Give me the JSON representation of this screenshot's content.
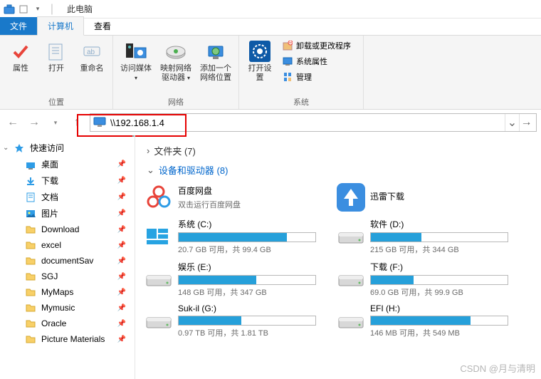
{
  "title": "此电脑",
  "tabs": {
    "file": "文件",
    "computer": "计算机",
    "view": "查看"
  },
  "ribbon": {
    "location": {
      "label": "位置",
      "props": "属性",
      "open": "打开",
      "rename": "重命名"
    },
    "network": {
      "label": "网络",
      "media": "访问媒体",
      "mapdrive": "映射网络驱动器",
      "addloc": "添加一个网络位置"
    },
    "system": {
      "label": "系统",
      "opensettings": "打开设置",
      "uninstall": "卸载或更改程序",
      "sysprops": "系统属性",
      "manage": "管理"
    }
  },
  "address": "\\\\192.168.1.4",
  "sidebar": {
    "quickaccess": "快速访问",
    "items": [
      {
        "label": "桌面"
      },
      {
        "label": "下载"
      },
      {
        "label": "文档"
      },
      {
        "label": "图片"
      },
      {
        "label": "Download"
      },
      {
        "label": "excel"
      },
      {
        "label": "documentSav"
      },
      {
        "label": "SGJ"
      },
      {
        "label": "MyMaps"
      },
      {
        "label": "Mymusic"
      },
      {
        "label": "Oracle"
      },
      {
        "label": "Picture Materials"
      }
    ]
  },
  "sections": {
    "folders": "文件夹 (7)",
    "devices": "设备和驱动器 (8)"
  },
  "apps": [
    {
      "name": "百度网盘",
      "sub": "双击运行百度网盘"
    },
    {
      "name": "迅雷下载",
      "sub": ""
    }
  ],
  "drives": [
    {
      "name": "系统 (C:)",
      "free": "20.7 GB 可用，共 99.4 GB",
      "pct": 79
    },
    {
      "name": "软件 (D:)",
      "free": "215 GB 可用，共 344 GB",
      "pct": 37
    },
    {
      "name": "娱乐 (E:)",
      "free": "148 GB 可用，共 347 GB",
      "pct": 57
    },
    {
      "name": "下载 (F:)",
      "free": "69.0 GB 可用，共 99.9 GB",
      "pct": 31
    },
    {
      "name": "Suk-il (G:)",
      "free": "0.97 TB 可用，共 1.81 TB",
      "pct": 46
    },
    {
      "name": "EFI (H:)",
      "free": "146 MB 可用，共 549 MB",
      "pct": 73
    }
  ],
  "watermark": "CSDN @月与清明"
}
